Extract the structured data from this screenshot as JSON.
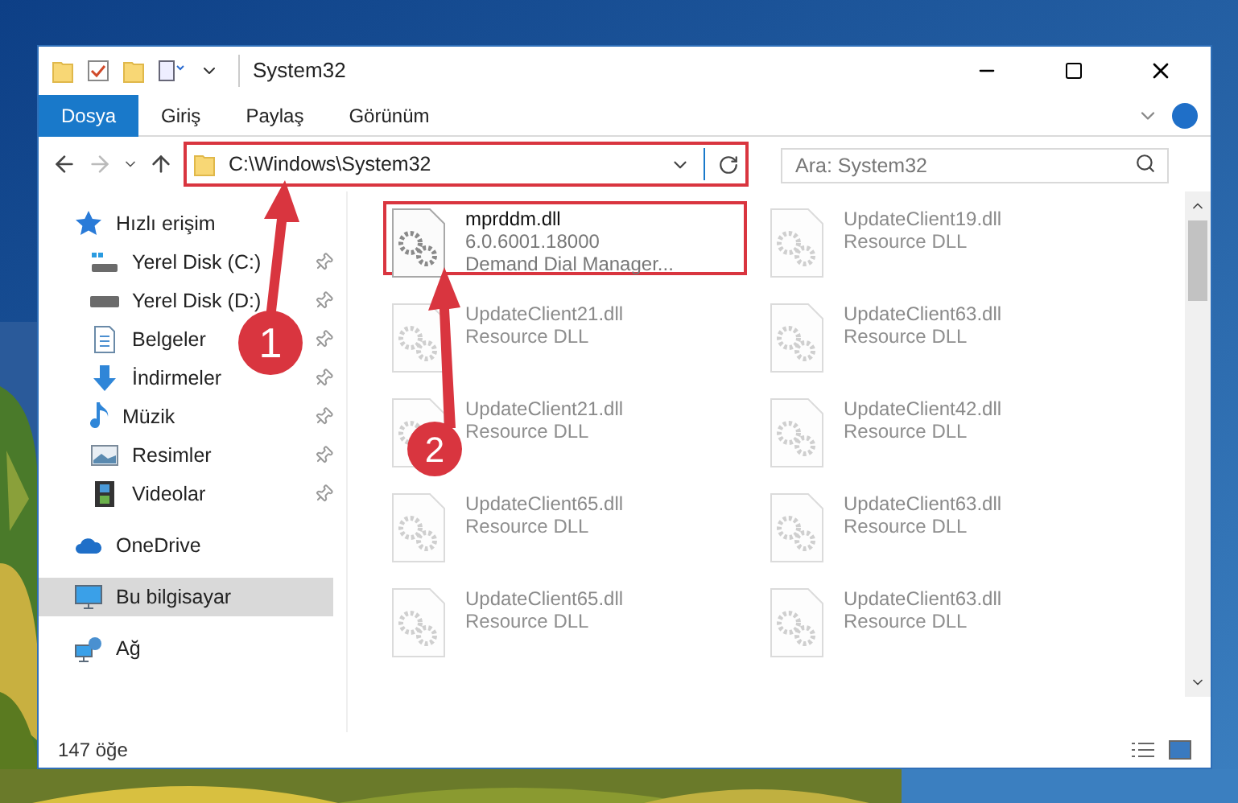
{
  "window": {
    "title": "System32"
  },
  "ribbon": {
    "tabs": [
      {
        "label": "Dosya",
        "selected": true
      },
      {
        "label": "Giriş",
        "selected": false
      },
      {
        "label": "Paylaş",
        "selected": false
      },
      {
        "label": "Görünüm",
        "selected": false
      }
    ]
  },
  "address_bar": {
    "path": "C:\\Windows\\System32",
    "annotated": true,
    "search": {
      "placeholder": "Ara: System32"
    }
  },
  "nav_pane": {
    "items": [
      {
        "label": "Hızlı erişim",
        "kind": "star",
        "selected": false,
        "children": [
          {
            "label": "Yerel Disk (C:)",
            "kind": "drive-win",
            "pinned": true
          },
          {
            "label": "Yerel Disk (D:)",
            "kind": "drive",
            "pinned": true
          },
          {
            "label": "Belgeler",
            "kind": "docs",
            "pinned": true
          },
          {
            "label": "İndirmeler",
            "kind": "download",
            "pinned": true
          },
          {
            "label": "Müzik",
            "kind": "music",
            "pinned": true
          },
          {
            "label": "Resimler",
            "kind": "pictures",
            "pinned": true
          },
          {
            "label": "Videolar",
            "kind": "videos",
            "pinned": true
          }
        ]
      },
      {
        "label": "OneDrive",
        "kind": "cloud",
        "selected": false
      },
      {
        "label": "Bu bilgisayar",
        "kind": "computer",
        "selected": true
      },
      {
        "label": "Ağ",
        "kind": "network",
        "selected": false
      }
    ]
  },
  "files": [
    {
      "name": "mprddm.dll",
      "lines": [
        "6.0.6001.18000",
        "Demand Dial Manager..."
      ],
      "annotated": true,
      "dimmed": false
    },
    {
      "name": "UpdateClient19.dll",
      "lines": [
        "Resource DLL"
      ],
      "annotated": false,
      "dimmed": true
    },
    {
      "name": "UpdateClient21.dll",
      "lines": [
        "Resource DLL"
      ],
      "annotated": false,
      "dimmed": true
    },
    {
      "name": "UpdateClient63.dll",
      "lines": [
        "Resource DLL"
      ],
      "annotated": false,
      "dimmed": true
    },
    {
      "name": "UpdateClient21.dll",
      "lines": [
        "Resource DLL"
      ],
      "annotated": false,
      "dimmed": true
    },
    {
      "name": "UpdateClient42.dll",
      "lines": [
        "Resource DLL"
      ],
      "annotated": false,
      "dimmed": true
    },
    {
      "name": "UpdateClient65.dll",
      "lines": [
        "Resource DLL"
      ],
      "annotated": false,
      "dimmed": true
    },
    {
      "name": "UpdateClient63.dll",
      "lines": [
        "Resource DLL"
      ],
      "annotated": false,
      "dimmed": true
    },
    {
      "name": "UpdateClient65.dll",
      "lines": [
        "Resource DLL"
      ],
      "annotated": false,
      "dimmed": true
    },
    {
      "name": "UpdateClient63.dll",
      "lines": [
        "Resource DLL"
      ],
      "annotated": false,
      "dimmed": true
    }
  ],
  "status_bar": {
    "item_count": "147 öğe"
  },
  "callouts": [
    {
      "number": "1"
    },
    {
      "number": "2"
    }
  ]
}
